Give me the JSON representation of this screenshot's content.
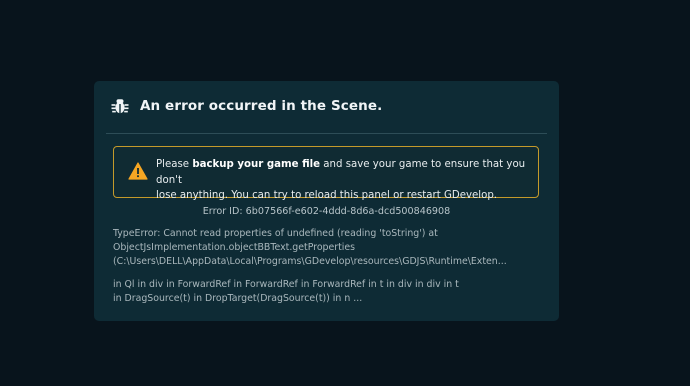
{
  "dialog": {
    "title": "An error occurred in the Scene.",
    "icon": "bug-icon"
  },
  "warning": {
    "icon": "warning-icon",
    "accent_color": "#c49a2a",
    "text_before": "Please ",
    "text_bold": "backup your game file",
    "text_after_line1": " and save your game to ensure that you don't",
    "text_line2": "lose anything. You can try to reload this panel or restart GDevelop."
  },
  "error": {
    "id_text": "Error ID: 6b07566f-e602-4ddd-8d6a-dcd500846908",
    "message_lines": [
      "TypeError: Cannot read properties of undefined (reading 'toString') at",
      "ObjectJsImplementation.objectBBText.getProperties",
      "(C:\\Users\\DELL\\AppData\\Local\\Programs\\GDevelop\\resources\\GDJS\\Runtime\\Exten..."
    ],
    "stack_lines": [
      "in Ql in div in ForwardRef in ForwardRef in ForwardRef in t in div in div in t",
      "in DragSource(t) in DropTarget(DragSource(t)) in n ..."
    ]
  }
}
